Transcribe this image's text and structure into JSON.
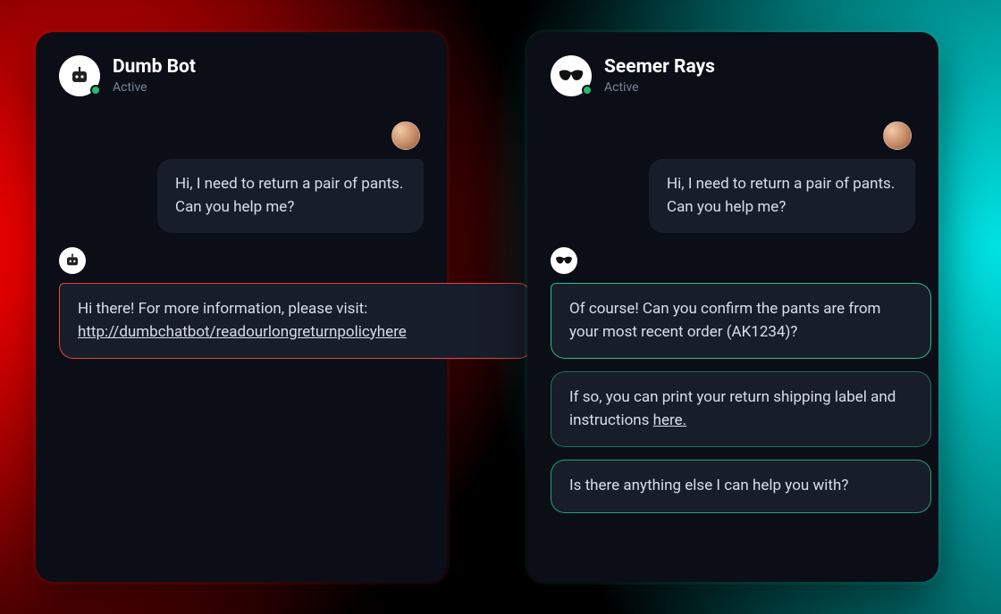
{
  "left": {
    "name": "Dumb Bot",
    "status": "Active",
    "user_message": "Hi, I need to return a pair of pants. Can you help me?",
    "reply_lead": "Hi there! For more information, please visit: ",
    "reply_link": "http://dumbchatbot/readourlongreturnpolicyhere"
  },
  "right": {
    "name": "Seemer Rays",
    "status": "Active",
    "user_message": "Hi, I need to return a pair of pants. Can you help me?",
    "reply1": "Of course!  Can you confirm the pants are from your most recent order (AK1234)?",
    "reply2_lead": "If so, you can print your return shipping label and instructions ",
    "reply2_link": "here.",
    "reply3": "Is there anything else I can help you with?"
  },
  "colors": {
    "accent_bad": "#ff4646",
    "accent_good": "#28dc96"
  }
}
